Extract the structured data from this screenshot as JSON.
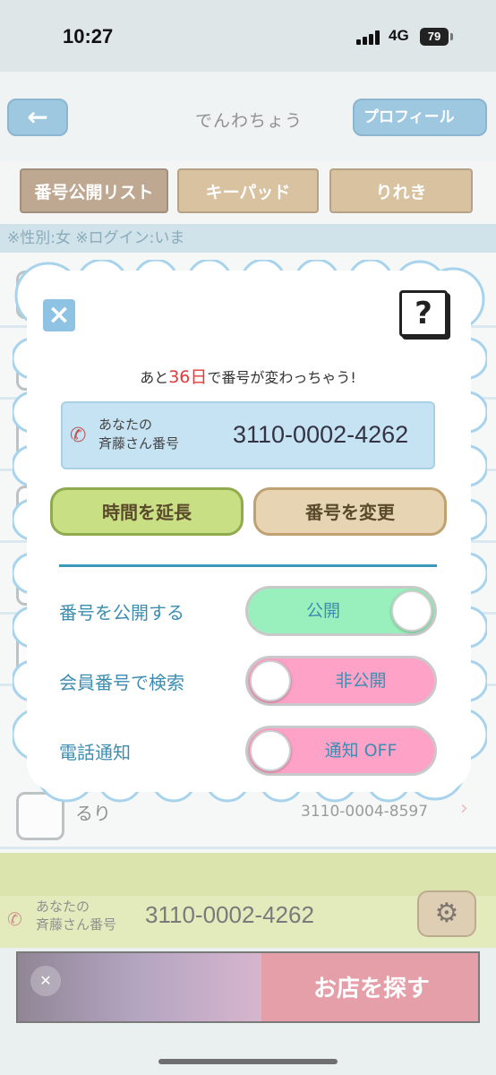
{
  "status_bar": {
    "time": "10:27",
    "network": "4G",
    "battery": "79"
  },
  "header": {
    "title": "でんわちょう",
    "back_icon": "←",
    "profile_label": "プロフィール"
  },
  "tabs": [
    {
      "label": "番号公開リスト"
    },
    {
      "label": "キーパッド"
    },
    {
      "label": "りれき"
    }
  ],
  "info_strip": "※性別:女 ※ログイン:いま",
  "list": {
    "visible_row": {
      "name": "るり",
      "number": "3110-0004-8597"
    }
  },
  "footer": {
    "label": "あなたの\n斉藤さん番号",
    "number": "3110-0002-4262"
  },
  "ad": {
    "cta": "お店を探す"
  },
  "modal": {
    "remaining_prefix": "あと",
    "remaining_days": "36日",
    "remaining_suffix": "で番号が変わっちゃう!",
    "card_label": "あなたの\n斉藤さん番号",
    "card_number": "3110-0002-4262",
    "extend_label": "時間を延長",
    "change_label": "番号を変更",
    "settings": [
      {
        "label": "番号を公開する",
        "state_label": "公開",
        "on": true
      },
      {
        "label": "会員番号で検索",
        "state_label": "非公開",
        "on": false
      },
      {
        "label": "電話通知",
        "state_label": "通知 OFF",
        "on": false
      }
    ],
    "close_icon": "×",
    "help_icon": "?"
  },
  "colors": {
    "accent_blue": "#3c8db0",
    "toggle_on": "#9af0bc",
    "toggle_off": "#ffa2c8",
    "days_red": "#e03a3a"
  }
}
